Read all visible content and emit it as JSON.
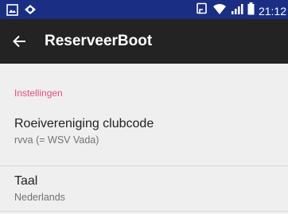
{
  "status_bar": {
    "time": "21:12",
    "icons": [
      "image-icon",
      "app-notification-icon",
      "nfc-icon",
      "wifi-icon",
      "signal-icon",
      "battery-icon"
    ]
  },
  "toolbar": {
    "title": "ReserveerBoot",
    "back_icon": "arrow-back-icon"
  },
  "settings": {
    "category": "Instellingen",
    "items": [
      {
        "title": "Roeivereniging clubcode",
        "summary": "rvva (= WSV Vada)"
      },
      {
        "title": "Taal",
        "summary": "Nederlands"
      }
    ]
  },
  "colors": {
    "status_bar": "#1a2e83",
    "toolbar": "#232323",
    "accent": "#e54a86",
    "background": "#efefef"
  }
}
